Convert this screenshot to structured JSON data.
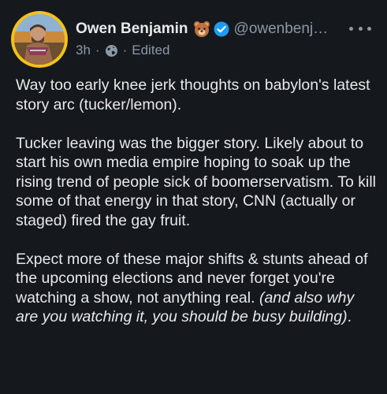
{
  "author": {
    "display_name": "Owen Benjamin",
    "name_emoji": "bear-face-icon",
    "verified_icon": "verified-badge-icon",
    "handle": "@owenbenj…",
    "timestamp": "3h",
    "meta_separator": "·",
    "visibility_icon": "globe-icon",
    "edited_label": "Edited",
    "avatar_ring_color": "#f2c21a"
  },
  "post": {
    "paragraphs": [
      "Way too early knee jerk thoughts on babylon's latest story arc (tucker/lemon).",
      "Tucker leaving was the bigger story. Likely about to start his own media empire hoping to soak up the rising trend of people sick of boomerservatism. To kill some of that energy in that story, CNN (actually or staged) fired the gay fruit.",
      "Expect more of these major shifts & stunts ahead of the upcoming elections and never forget you're watching a show, not anything real."
    ],
    "italic_tail": "(and also why are you watching it, you should be busy building)",
    "final_period": "."
  },
  "colors": {
    "background": "#15181c",
    "text_primary": "#e7e9ea",
    "text_secondary": "#8b98a5",
    "verified_blue": "#1d9bf0"
  }
}
